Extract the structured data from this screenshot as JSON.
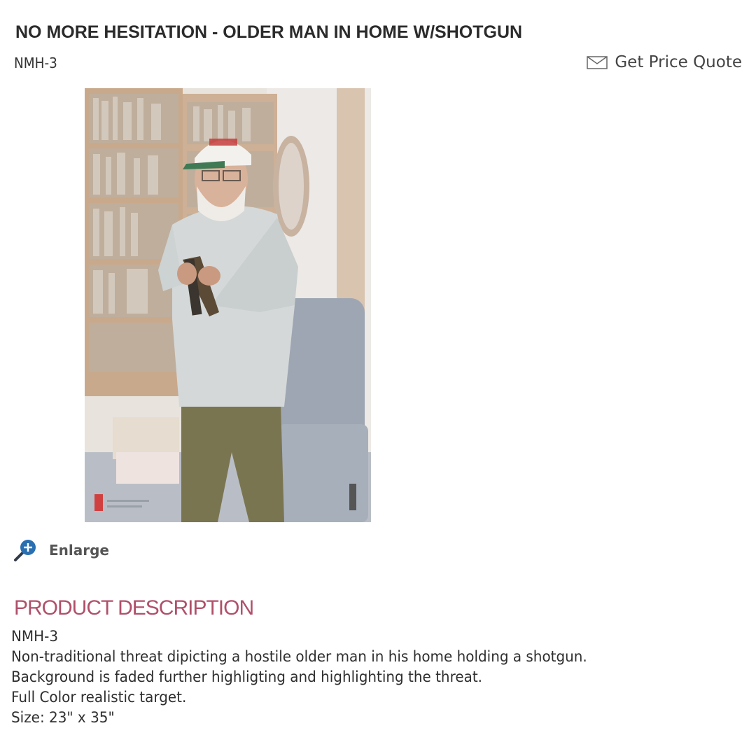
{
  "product": {
    "title": "NO MORE HESITATION - OLDER MAN IN HOME W/SHOTGUN",
    "sku": "NMH-3"
  },
  "actions": {
    "quote_label": "Get Price Quote",
    "quote_icon": "envelope-icon",
    "enlarge_label": "Enlarge",
    "enlarge_icon": "magnifier-plus-icon"
  },
  "image": {
    "subject": "older man holding a shotgun in his home",
    "logo_text": ""
  },
  "description": {
    "heading": "PRODUCT DESCRIPTION",
    "lines": [
      "NMH-3",
      "Non-traditional threat dipicting a hostile older man in his home holding a shotgun.",
      "Background is faded further highligting and highlighting the threat.",
      "Full Color realistic target.",
      "Size: 23\" x 35\""
    ]
  },
  "colors": {
    "heading_accent": "#b0506a",
    "icon_blue": "#2a6fb0"
  }
}
